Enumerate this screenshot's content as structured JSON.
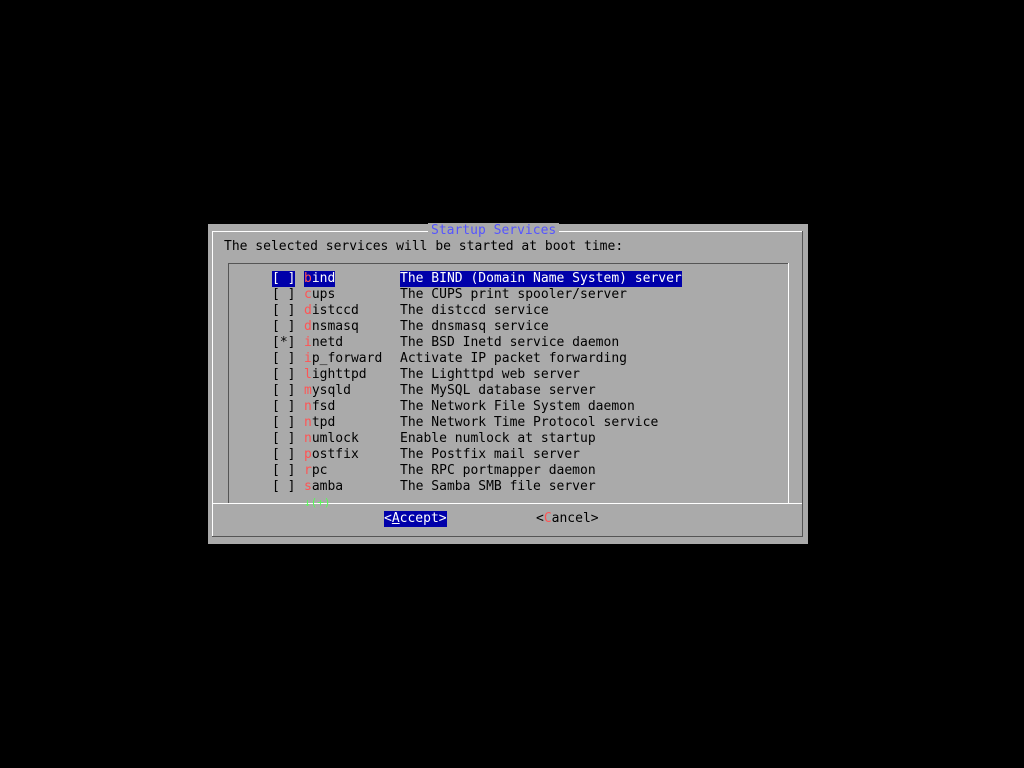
{
  "dialog": {
    "title": "Startup Services",
    "prompt": "The selected services will be started at boot time:"
  },
  "services": [
    {
      "check": "[ ]",
      "hot": "b",
      "rest": "ind",
      "desc": "The BIND (Domain Name System) server",
      "selected": true
    },
    {
      "check": "[ ]",
      "hot": "c",
      "rest": "ups",
      "desc": "The CUPS print spooler/server"
    },
    {
      "check": "[ ]",
      "hot": "d",
      "rest": "istccd",
      "desc": "The distccd service"
    },
    {
      "check": "[ ]",
      "hot": "d",
      "rest": "nsmasq",
      "desc": "The dnsmasq service"
    },
    {
      "check": "[*]",
      "hot": "i",
      "rest": "netd",
      "desc": "The BSD Inetd service daemon"
    },
    {
      "check": "[ ]",
      "hot": "i",
      "rest": "p_forward",
      "desc": "Activate IP packet forwarding"
    },
    {
      "check": "[ ]",
      "hot": "l",
      "rest": "ighttpd",
      "desc": "The Lighttpd web server"
    },
    {
      "check": "[ ]",
      "hot": "m",
      "rest": "ysqld",
      "desc": "The MySQL database server"
    },
    {
      "check": "[ ]",
      "hot": "n",
      "rest": "fsd",
      "desc": "The Network File System daemon"
    },
    {
      "check": "[ ]",
      "hot": "n",
      "rest": "tpd",
      "desc": "The Network Time Protocol service"
    },
    {
      "check": "[ ]",
      "hot": "n",
      "rest": "umlock",
      "desc": "Enable numlock at startup"
    },
    {
      "check": "[ ]",
      "hot": "p",
      "rest": "ostfix",
      "desc": "The Postfix mail server"
    },
    {
      "check": "[ ]",
      "hot": "r",
      "rest": "pc",
      "desc": "The RPC portmapper daemon"
    },
    {
      "check": "[ ]",
      "hot": "s",
      "rest": "amba",
      "desc": "The Samba SMB file server"
    }
  ],
  "scroll_indicator": "↓(+)",
  "buttons": {
    "accept": {
      "open": "<",
      "hot": "A",
      "rest": "ccept",
      "close": ">"
    },
    "cancel": {
      "open": "<",
      "hot": "C",
      "rest": "ancel",
      "close": ">"
    }
  },
  "colors": {
    "background": "#000000",
    "dialog": "#aaaaaa",
    "title": "#5555ff",
    "hotkey": "#ff5555",
    "selection": "#0000aa",
    "indicator": "#55ff55"
  }
}
